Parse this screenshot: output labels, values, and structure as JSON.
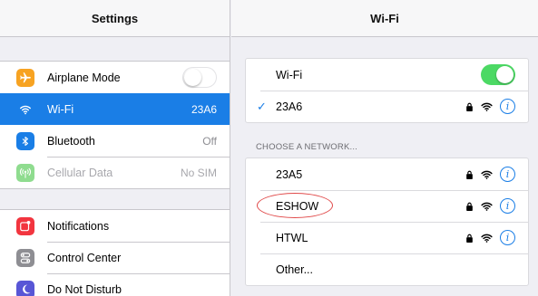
{
  "master": {
    "title": "Settings",
    "groups": [
      {
        "items": [
          {
            "label": "Airplane Mode",
            "value": "",
            "icon": "airplane-icon",
            "color": "#f7a322",
            "toggle": "off"
          },
          {
            "label": "Wi-Fi",
            "value": "23A6",
            "icon": "wifi-icon",
            "color": "#1a7ee6",
            "selected": true
          },
          {
            "label": "Bluetooth",
            "value": "Off",
            "icon": "bluetooth-icon",
            "color": "#1a7ee6"
          },
          {
            "label": "Cellular Data",
            "value": "No SIM",
            "icon": "cellular-icon",
            "color": "#8fdc8f",
            "disabled": true
          }
        ]
      },
      {
        "items": [
          {
            "label": "Notifications",
            "icon": "notifications-icon",
            "color": "#f2353f"
          },
          {
            "label": "Control Center",
            "icon": "control-center-icon",
            "color": "#8e8e93"
          },
          {
            "label": "Do Not Disturb",
            "icon": "moon-icon",
            "color": "#5856d6"
          }
        ]
      }
    ]
  },
  "detail": {
    "title": "Wi-Fi",
    "wifi_toggle": {
      "label": "Wi-Fi",
      "state": "on"
    },
    "connected": {
      "name": "23A6",
      "secured": true
    },
    "section_header": "CHOOSE A NETWORK...",
    "networks": [
      {
        "name": "23A5",
        "secured": true
      },
      {
        "name": "ESHOW",
        "secured": true
      },
      {
        "name": "HTWL",
        "secured": true
      }
    ],
    "other_label": "Other...",
    "info_glyph": "i",
    "checkmark": "✓"
  },
  "colors": {
    "accent": "#1a7ee6",
    "toggle_on": "#4cd964",
    "annotation": "#e04848"
  }
}
